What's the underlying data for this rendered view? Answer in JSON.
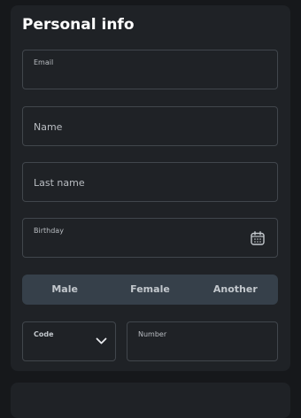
{
  "section": {
    "title": "Personal info"
  },
  "fields": {
    "email": {
      "label": "Email",
      "value": ""
    },
    "name": {
      "label": "Name",
      "value": ""
    },
    "last_name": {
      "label": "Last name",
      "value": ""
    },
    "birthday": {
      "label": "Birthday",
      "value": ""
    }
  },
  "gender": {
    "options": [
      "Male",
      "Female",
      "Another"
    ]
  },
  "phone": {
    "code_label": "Code",
    "number_label": "Number"
  },
  "icons": {
    "birthday": "calendar-icon",
    "code": "chevron-down-icon"
  },
  "colors": {
    "background": "#16181b",
    "card": "#1f2226",
    "border": "#41464c",
    "segment": "#36404a"
  }
}
